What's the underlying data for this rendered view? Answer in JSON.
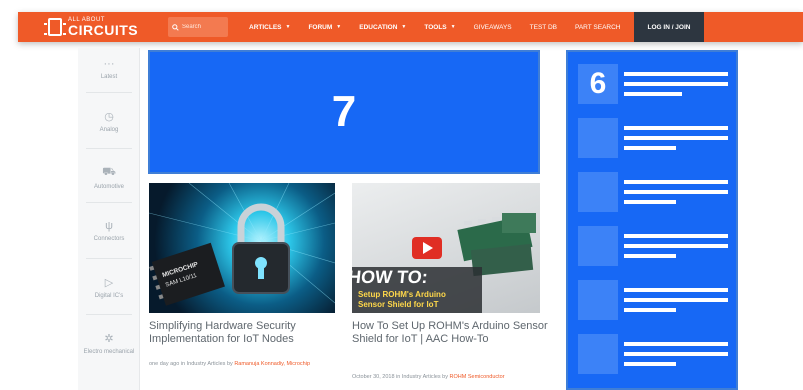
{
  "navbar": {
    "logo_small": "ALL ABOUT",
    "logo_big": "CIRCUITS",
    "search_placeholder": "Search",
    "menu": [
      {
        "label": "ARTICLES"
      },
      {
        "label": "FORUM"
      },
      {
        "label": "EDUCATION"
      },
      {
        "label": "TOOLS"
      },
      {
        "label": "GIVEAWAYS"
      },
      {
        "label": "TEST DB"
      },
      {
        "label": "PART SEARCH"
      }
    ],
    "login_label": "LOG IN / JOIN",
    "color_bar": "#ef5a28",
    "color_login": "#2d3640"
  },
  "sidebar": {
    "items": [
      {
        "label": "Latest",
        "icon": "dots-icon"
      },
      {
        "label": "Analog",
        "icon": "clock-icon"
      },
      {
        "label": "Automotive",
        "icon": "truck-icon"
      },
      {
        "label": "Connectors",
        "icon": "usb-icon"
      },
      {
        "label": "Digital IC's",
        "icon": "logic-gate-icon"
      },
      {
        "label": "Electro mechanical",
        "icon": "gear-icon"
      }
    ]
  },
  "ads": {
    "banner_label": "7",
    "side_label": "6",
    "color": "#1768f5"
  },
  "articles": [
    {
      "title": "Simplifying Hardware Security Implementation for IoT Nodes",
      "meta_prefix": "one day ago in Industry Articles by",
      "author": "Ramanuja Konnadiy, Microchip",
      "image_text": "MICROCHIP SAM L10/11"
    },
    {
      "title": "How To Set Up ROHM's Arduino Sensor Shield for IoT | AAC How-To",
      "meta_prefix": "October 30, 2018 in Industry Articles by",
      "author": "ROHM Semiconductor",
      "image_text_1": "HOW TO:",
      "image_text_2": "Setup ROHM's Arduino Sensor Shield for IoT"
    }
  ]
}
